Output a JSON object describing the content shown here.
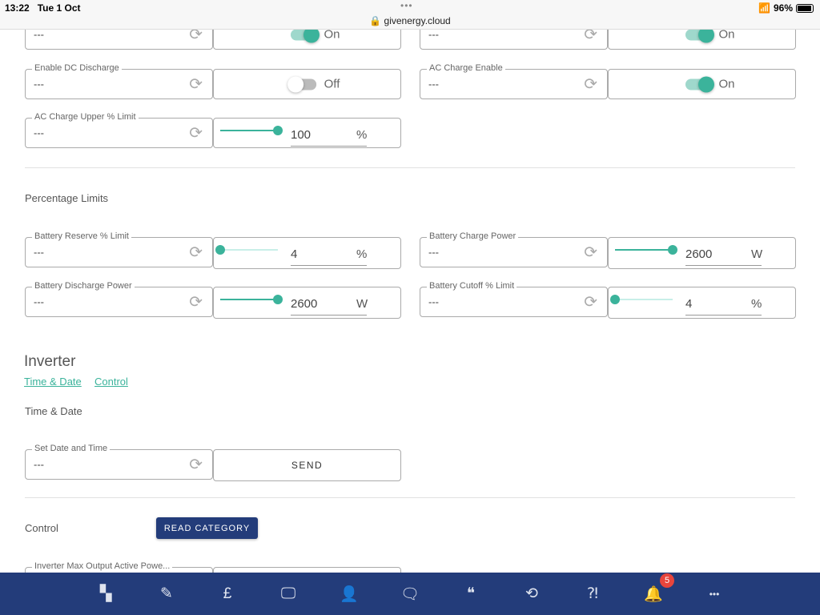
{
  "status_bar": {
    "time": "13:22",
    "date": "Tue 1 Oct",
    "url": "givenergy.cloud",
    "battery": "96%",
    "dots": "•••"
  },
  "fields": [
    {
      "label": "",
      "value": "---",
      "control": "toggle",
      "state": "On",
      "on": true,
      "col": 0,
      "row": 0
    },
    {
      "label": "",
      "value": "---",
      "control": "toggle",
      "state": "On",
      "on": true,
      "col": 1,
      "row": 0
    },
    {
      "label": "Enable DC Discharge",
      "value": "---",
      "control": "toggle",
      "state": "Off",
      "on": false,
      "col": 0,
      "row": 1
    },
    {
      "label": "AC Charge Enable",
      "value": "---",
      "control": "toggle",
      "state": "On",
      "on": true,
      "col": 1,
      "row": 1
    },
    {
      "label": "AC Charge Upper % Limit",
      "value": "---",
      "control": "slider",
      "number": "100",
      "unit": "%",
      "level": 1.0,
      "col": 0,
      "row": 2
    },
    {
      "label": "Battery Reserve % Limit",
      "value": "---",
      "control": "slider",
      "number": "4",
      "unit": "%",
      "level": 0.0,
      "col": 0,
      "row": 3
    },
    {
      "label": "Battery Charge Power",
      "value": "---",
      "control": "slider",
      "number": "2600",
      "unit": "W",
      "level": 1.0,
      "col": 1,
      "row": 3
    },
    {
      "label": "Battery Discharge Power",
      "value": "---",
      "control": "slider",
      "number": "2600",
      "unit": "W",
      "level": 1.0,
      "col": 0,
      "row": 4
    },
    {
      "label": "Battery Cutoff % Limit",
      "value": "---",
      "control": "slider",
      "number": "4",
      "unit": "%",
      "level": 0.0,
      "col": 1,
      "row": 4
    },
    {
      "label": "Set Date and Time",
      "value": "---",
      "control": "send",
      "button": "SEND",
      "col": 0,
      "row": 5
    },
    {
      "label": "Inverter Max Output Active Powe...",
      "value": "",
      "control": "empty",
      "col": 0,
      "row": 6
    }
  ],
  "sections": {
    "percentage_limits": "Percentage Limits",
    "inverter": "Inverter",
    "link_time_date": "Time & Date",
    "link_control": "Control",
    "time_date": "Time & Date",
    "control": "Control",
    "read_category": "READ CATEGORY"
  },
  "nav": {
    "items": [
      "dashboard",
      "edit",
      "pricing",
      "monitor",
      "account-settings",
      "messages",
      "feedback",
      "sync-alert",
      "help",
      "notifications",
      "more"
    ],
    "notification_count": "5"
  },
  "colors": {
    "accent": "#3bb39b",
    "nav": "#233c7a",
    "badge": "#e8453c"
  }
}
